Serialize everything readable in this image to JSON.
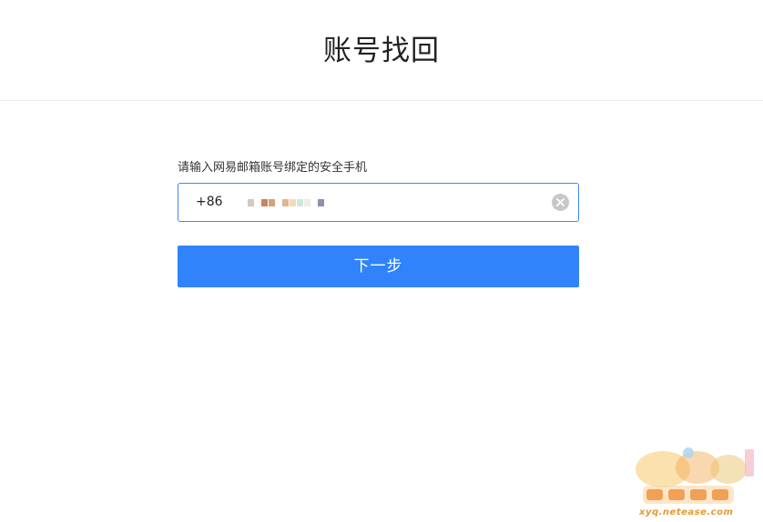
{
  "header": {
    "title": "账号找回"
  },
  "form": {
    "prompt": "请输入网易邮箱账号绑定的安全手机",
    "country_code": "+86",
    "next_label": "下一步"
  },
  "watermark": {
    "text": "xyq.netease.com"
  }
}
